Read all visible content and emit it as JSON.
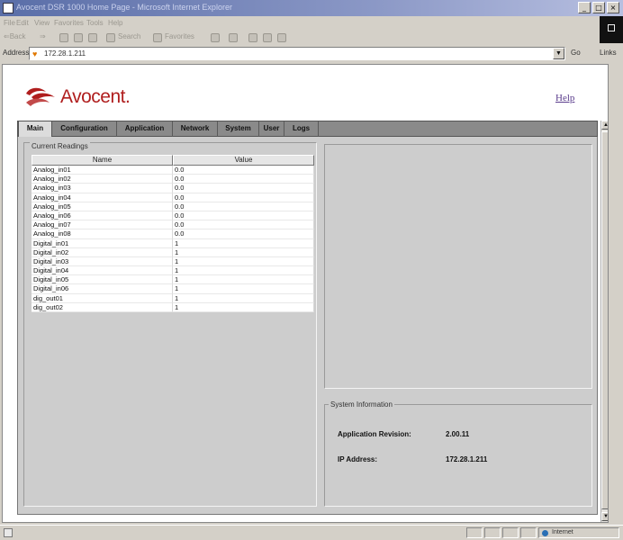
{
  "window": {
    "title": "Avocent DSR 1000 Home Page - Microsoft Internet Explorer",
    "controls": [
      "_",
      "□",
      "×"
    ]
  },
  "menubar": {
    "items": [
      "File",
      "Edit",
      "View",
      "Favorites",
      "Tools",
      "Help"
    ]
  },
  "toolbar": {
    "back": "⇐Back",
    "forward": "⇒",
    "search": "Search",
    "favorites": "Favorites"
  },
  "addressbar": {
    "label": "Address",
    "url": "172.28.1.211",
    "go": "Go",
    "links": "Links"
  },
  "header": {
    "logo_text": "Avocent.",
    "help_link": "Help"
  },
  "tabs": [
    {
      "label": "Main",
      "active": true
    },
    {
      "label": "Configuration",
      "active": false
    },
    {
      "label": "Application",
      "active": false
    },
    {
      "label": "Network",
      "active": false
    },
    {
      "label": "System",
      "active": false
    },
    {
      "label": "User",
      "active": false
    },
    {
      "label": "Logs",
      "active": false
    }
  ],
  "readings": {
    "group_label": "Current Readings",
    "columns": [
      "Name",
      "Value"
    ],
    "rows": [
      {
        "name": "Analog_in01",
        "value": "0.0"
      },
      {
        "name": "Analog_in02",
        "value": "0.0"
      },
      {
        "name": "Analog_in03",
        "value": "0.0"
      },
      {
        "name": "Analog_in04",
        "value": "0.0"
      },
      {
        "name": "Analog_in05",
        "value": "0.0"
      },
      {
        "name": "Analog_in06",
        "value": "0.0"
      },
      {
        "name": "Analog_in07",
        "value": "0.0"
      },
      {
        "name": "Analog_in08",
        "value": "0.0"
      },
      {
        "name": "Digital_in01",
        "value": "1"
      },
      {
        "name": "Digital_in02",
        "value": "1"
      },
      {
        "name": "Digital_in03",
        "value": "1"
      },
      {
        "name": "Digital_in04",
        "value": "1"
      },
      {
        "name": "Digital_in05",
        "value": "1"
      },
      {
        "name": "Digital_in06",
        "value": "1"
      },
      {
        "name": "dig_out01",
        "value": "1"
      },
      {
        "name": "dig_out02",
        "value": "1"
      }
    ]
  },
  "system_info": {
    "group_label": "System Information",
    "app_revision_label": "Application Revision:",
    "app_revision_value": "2.00.11",
    "ip_label": "IP Address:",
    "ip_value": "172.28.1.211"
  },
  "statusbar": {
    "zone": "Internet"
  },
  "colors": {
    "brand": "#b01e1e",
    "panel": "#cdcdcd",
    "tab_strip": "#8a8a8a"
  }
}
